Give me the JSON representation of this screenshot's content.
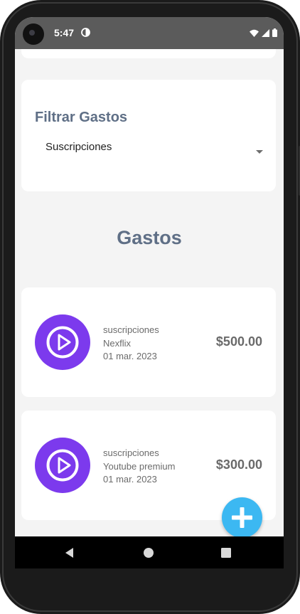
{
  "status_bar": {
    "time": "5:47",
    "icons": [
      "app-notification-icon",
      "wifi-icon",
      "signal-icon",
      "battery-icon"
    ]
  },
  "filter": {
    "title": "Filtrar Gastos",
    "selected": "Suscripciones"
  },
  "section_title": "Gastos",
  "expenses": [
    {
      "category": "suscripciones",
      "name": "Nexflix",
      "date": "01 mar. 2023",
      "amount": "$500.00",
      "icon": "play-circle-icon"
    },
    {
      "category": "suscripciones",
      "name": "Youtube premium",
      "date": "01 mar. 2023",
      "amount": "$300.00",
      "icon": "play-circle-icon"
    }
  ],
  "colors": {
    "accent_purple": "#7c3aed",
    "fab_blue": "#3cb8f2",
    "title_slate": "#5f6f86",
    "background": "#f4f4f4"
  },
  "fab": {
    "icon": "plus-icon"
  },
  "navigation": {
    "icons": [
      "back-icon",
      "home-icon",
      "recents-icon"
    ]
  }
}
